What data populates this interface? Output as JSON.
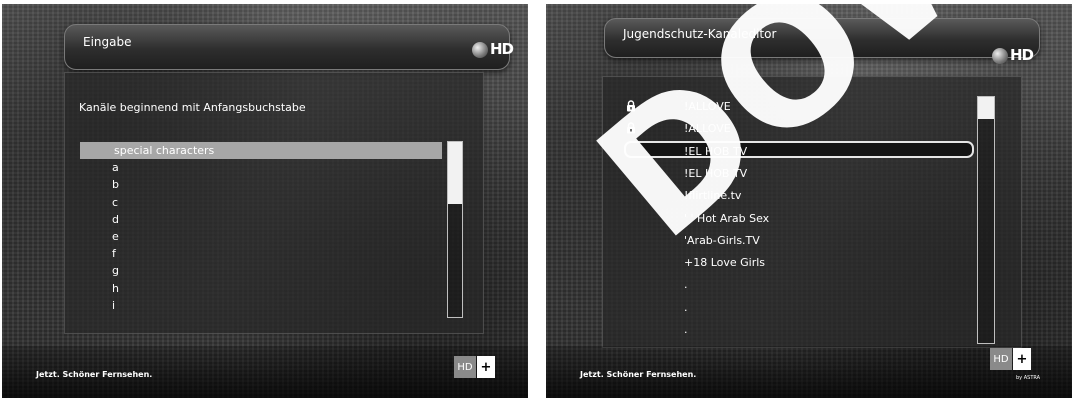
{
  "left_screen": {
    "title": "Eingabe",
    "channel_logo": "HD",
    "heading": "Kanäle beginnend mit Anfangsbuchstabe",
    "items": [
      {
        "label": "special characters",
        "selected": true
      },
      {
        "label": "a"
      },
      {
        "label": "b"
      },
      {
        "label": "c"
      },
      {
        "label": "d"
      },
      {
        "label": "e"
      },
      {
        "label": "f"
      },
      {
        "label": "g"
      },
      {
        "label": "h"
      },
      {
        "label": "i"
      }
    ],
    "scroll_fraction_visible": 0.3,
    "footer": {
      "slogan": "Jetzt. Schöner Fernsehen.",
      "badge_hd": "HD",
      "badge_plus": "+"
    }
  },
  "right_screen": {
    "title": "Jugendschutz-Kanaleditor",
    "channel_logo": "HD",
    "items": [
      {
        "label": "!ALLOVE",
        "locked": true
      },
      {
        "label": "!ALLOVE",
        "locked": true
      },
      {
        "label": "!EL HOB TV",
        "focused": true
      },
      {
        "label": "!EL HOB TV"
      },
      {
        "label": "!flirtline.tv"
      },
      {
        "label": "' ' Hot Arab Sex"
      },
      {
        "label": "'Arab-Girls.TV"
      },
      {
        "label": "+18 Love Girls"
      },
      {
        "label": "."
      },
      {
        "label": "."
      },
      {
        "label": "."
      }
    ],
    "scroll_fraction_visible": 0.09,
    "footer": {
      "slogan": "Jetzt. Schöner Fernsehen.",
      "badge_hd": "HD",
      "badge_plus": "+",
      "astra_caption": "by ASTRA"
    },
    "watermark": "DOWNL"
  },
  "icons": {
    "lock": "lock-icon",
    "ball": "satellite-ball-icon"
  }
}
